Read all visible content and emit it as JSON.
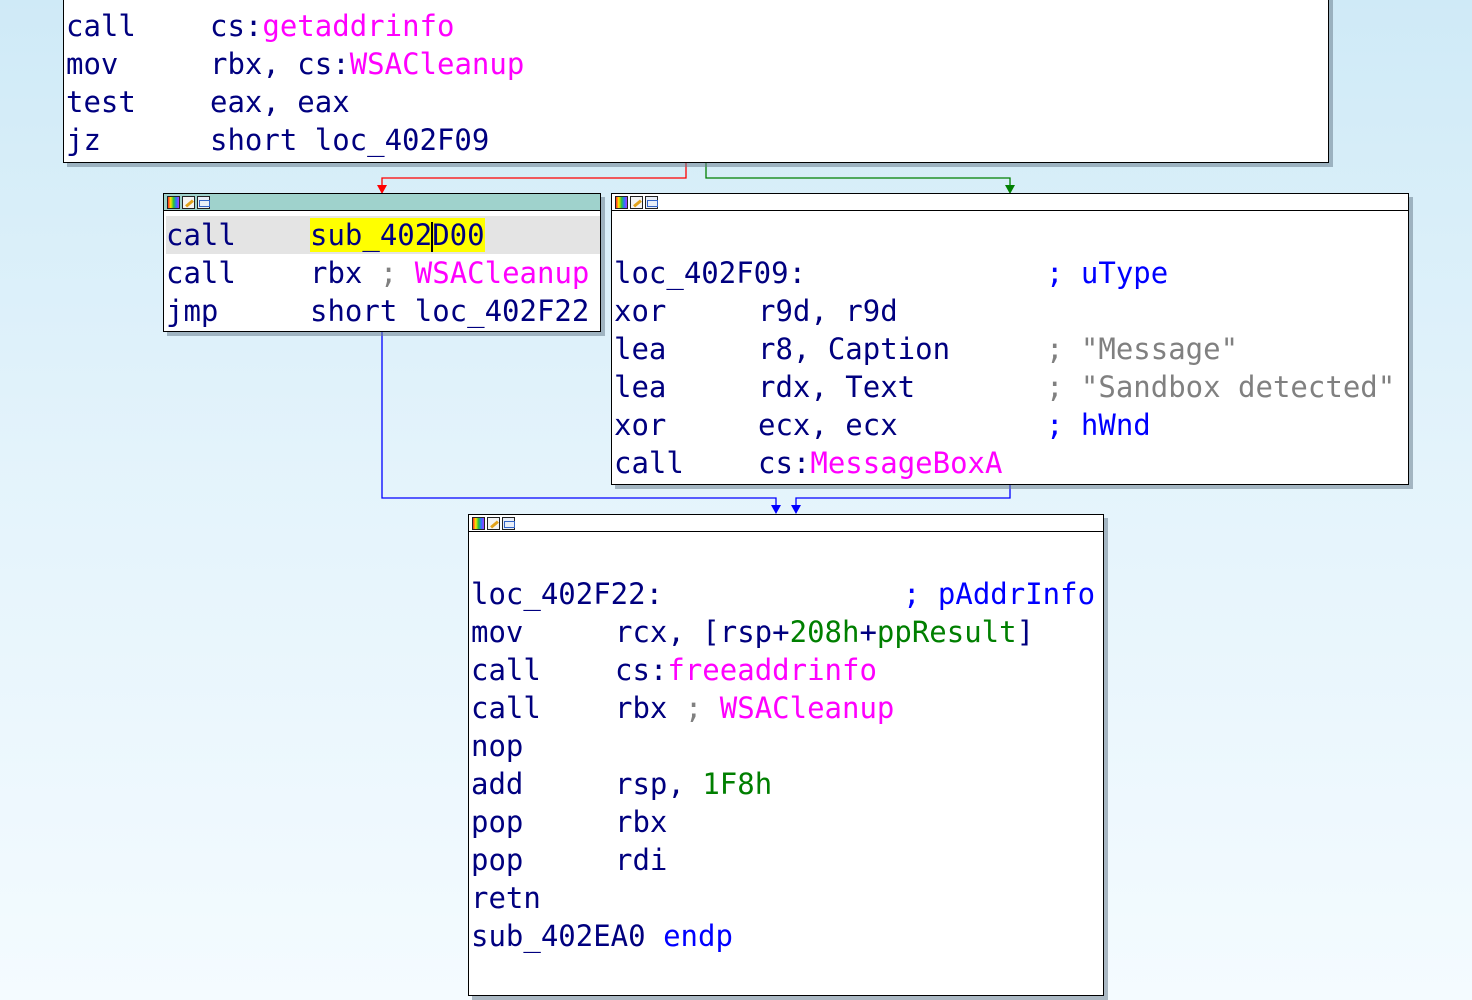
{
  "colors": {
    "text": "#00007f",
    "import": "#ff00ff",
    "number": "#007f00",
    "comment": "#0000ff",
    "string": "#808080",
    "edge_true": "#008000",
    "edge_false": "#ff0000",
    "edge_jump": "#0000ff",
    "active_header": "#9fd2cc",
    "highlight": "#ffff00"
  },
  "header_icons": [
    "palette-icon",
    "edit-icon",
    "graph-icon"
  ],
  "block_top": {
    "lines": [
      {
        "mn": "call",
        "op_a": "cs:",
        "op_b": "getaddrinfo"
      },
      {
        "mn": "mov",
        "op_a": "rbx, cs:",
        "op_b": "WSACleanup"
      },
      {
        "mn": "test",
        "op": "eax, eax"
      },
      {
        "mn": "jz",
        "op": "short loc_402F09"
      }
    ]
  },
  "block_left": {
    "call1": {
      "mn": "call",
      "hl_a": "sub_402",
      "hl_b": "D00"
    },
    "call2": {
      "mn": "call",
      "op": "rbx",
      "sep": " ; ",
      "cmt": "WSACleanup"
    },
    "jmp": {
      "mn": "jmp",
      "op": "short loc_402F22"
    }
  },
  "block_right": {
    "label": "loc_402F09:",
    "label_comment": "; uType",
    "lines": [
      {
        "mn": "xor",
        "op": "r9d, r9d",
        "sep": "",
        "cmt": ""
      },
      {
        "mn": "lea",
        "op": "r8, Caption",
        "sep": "; ",
        "cmt": "\"Message\""
      },
      {
        "mn": "lea",
        "op": "rdx, Text",
        "sep": "; ",
        "cmt": "\"Sandbox detected\""
      },
      {
        "mn": "xor",
        "op": "ecx, ecx",
        "sep": "; hWnd",
        "cmt": ""
      }
    ],
    "call": {
      "mn": "call",
      "op_a": "cs:",
      "op_b": "MessageBoxA"
    }
  },
  "block_bottom": {
    "label": "loc_402F22:",
    "label_comment": "; pAddrInfo",
    "mov": {
      "mn": "mov",
      "a": "rcx, [rsp+",
      "b": "208h",
      "c": "+",
      "d": "ppResult",
      "e": "]"
    },
    "call1": {
      "mn": "call",
      "op_a": "cs:",
      "op_b": "freeaddrinfo"
    },
    "call2": {
      "mn": "call",
      "op": "rbx",
      "sep": " ; ",
      "cmt": "WSACleanup"
    },
    "nop": {
      "mn": "nop"
    },
    "add": {
      "mn": "add",
      "op": "rsp, ",
      "num": "1F8h"
    },
    "pop1": {
      "mn": "pop",
      "op": "rbx"
    },
    "pop2": {
      "mn": "pop",
      "op": "rdi"
    },
    "retn": {
      "mn": "retn"
    },
    "endp": {
      "name": "sub_402EA0 ",
      "kw": "endp"
    }
  }
}
